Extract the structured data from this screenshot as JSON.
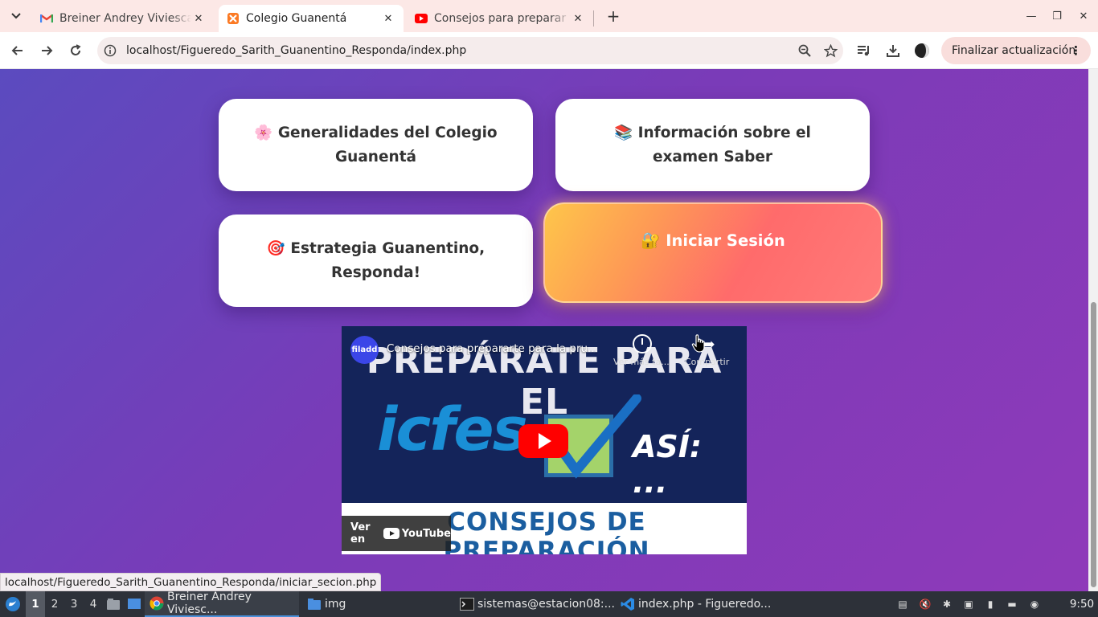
{
  "browser": {
    "tabs": [
      {
        "title": "Breiner Andrey Viviescas",
        "favicon": "gmail-icon",
        "active": false
      },
      {
        "title": "Colegio Guanentá",
        "favicon": "xampp-icon",
        "active": true
      },
      {
        "title": "Consejos para preparar te",
        "favicon": "youtube-icon",
        "active": false
      }
    ],
    "address": "localhost/Figueredo_Sarith_Guanentino_Responda/index.php",
    "update_button": "Finalizar actualización"
  },
  "page": {
    "cards": {
      "generalidades": {
        "emoji": "🌸",
        "label": "Generalidades del Colegio Guanentá"
      },
      "informacion": {
        "emoji": "📚",
        "label": "Información sobre el examen Saber"
      },
      "estrategia": {
        "emoji": "🎯",
        "label": "Estrategia Guanentino, Responda!"
      },
      "login": {
        "emoji": "🔐",
        "label": "Iniciar Sesión"
      }
    },
    "video": {
      "channel": "filadd",
      "title": "Consejos para prepararte para la pru...",
      "watch_later": "Ver más ta...",
      "share": "Compartir",
      "banner_top": "PREPÁRATE PARA EL",
      "banner_icfes": "icfes",
      "banner_asi": "ASÍ: ...",
      "banner_bottom": "CONSEJOS DE PREPARACIÓN",
      "watch_on": "Ver en",
      "youtube": "YouTube"
    },
    "status_url": "localhost/Figueredo_Sarith_Guanentino_Responda/iniciar_secion.php"
  },
  "taskbar": {
    "workspaces": [
      "1",
      "2",
      "3",
      "4"
    ],
    "apps": [
      {
        "label": "Breiner Andrey Viviesc...",
        "icon": "chrome-icon",
        "active": true
      },
      {
        "label": "img",
        "icon": "folder-icon",
        "active": false
      },
      {
        "label": "sistemas@estacion08:...",
        "icon": "terminal-icon",
        "active": false
      },
      {
        "label": "index.php - Figueredo...",
        "icon": "vscode-icon",
        "active": false
      }
    ],
    "clock": "9:50"
  },
  "colors": {
    "page_gradient_start": "#5b4bbf",
    "page_gradient_end": "#8f3ab9",
    "login_gradient_start": "#fec64a",
    "login_gradient_end": "#ff6b6b",
    "tabstrip": "#fce8e6"
  }
}
